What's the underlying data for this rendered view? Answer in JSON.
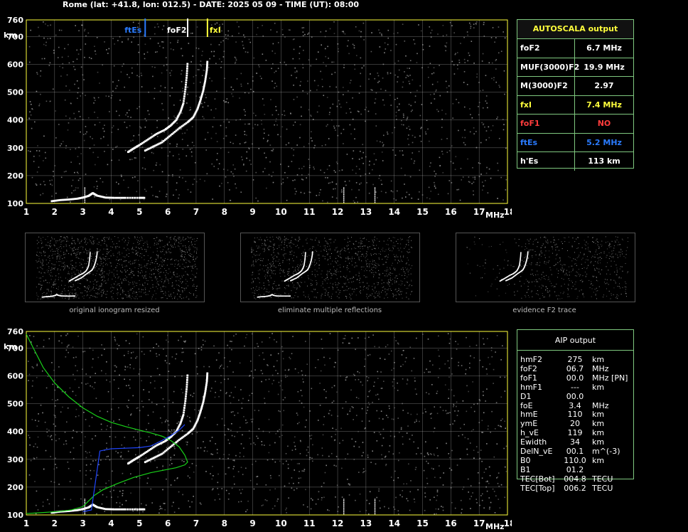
{
  "header": {
    "title": "Rome (lat: +41.8, lon: 012.5) - DATE: 2025 05 09 - TIME (UT): 08:00"
  },
  "colors": {
    "grid": "#c8c8c8",
    "axis": "#ffff3c",
    "trace": "#ffffff",
    "noise": "#8c8c8c",
    "ftEs": "#2a7bff",
    "fxI": "#ffff3c",
    "green": "#19d119",
    "blue": "#2046ff",
    "table_border": "#7fc87f",
    "foF1_red": "#ff3c3c"
  },
  "autoscala": {
    "title": "AUTOSCALA output",
    "rows": [
      {
        "label": "foF2",
        "value": "6.7  MHz",
        "color": "#ffffff"
      },
      {
        "label": "MUF(3000)F2",
        "value": "19.9 MHz",
        "color": "#ffffff"
      },
      {
        "label": "M(3000)F2",
        "value": "2.97",
        "color": "#ffffff"
      },
      {
        "label": "fxI",
        "value": "7.4  MHz",
        "color": "#ffff3c"
      },
      {
        "label": "foF1",
        "value": "NO",
        "color": "#ff3c3c"
      },
      {
        "label": "ftEs",
        "value": "5.2  MHz",
        "color": "#2a7bff"
      },
      {
        "label": "h'Es",
        "value": "113    km",
        "color": "#ffffff"
      }
    ]
  },
  "aip": {
    "title": "AIP output",
    "rows": [
      {
        "param": "hmF2",
        "value": "275",
        "unit": "km"
      },
      {
        "param": "foF2",
        "value": "06.7",
        "unit": "MHz"
      },
      {
        "param": "foF1",
        "value": "00.0",
        "unit": "MHz    [PN]"
      },
      {
        "param": "hmF1",
        "value": "---",
        "unit": "km"
      },
      {
        "param": "D1",
        "value": "00.0",
        "unit": ""
      },
      {
        "param": "foE",
        "value": "3.4",
        "unit": "MHz"
      },
      {
        "param": "hmE",
        "value": "110",
        "unit": "km"
      },
      {
        "param": "ymE",
        "value": "20",
        "unit": "km"
      },
      {
        "param": "h_vE",
        "value": "119",
        "unit": "km"
      },
      {
        "param": "Ewidth",
        "value": "34",
        "unit": "km"
      },
      {
        "param": "DelN_vE",
        "value": "00.1",
        "unit": "m^(-3)"
      },
      {
        "param": "B0",
        "value": "110.0",
        "unit": "km"
      },
      {
        "param": "B1",
        "value": "01.2",
        "unit": ""
      },
      {
        "param": "TEC[Bot]",
        "value": "004.8",
        "unit": "TECU"
      },
      {
        "param": "TEC[Top]",
        "value": "006.2",
        "unit": "TECU"
      }
    ]
  },
  "thumbnails": [
    {
      "caption": "original ionogram resized"
    },
    {
      "caption": "eliminate multiple reflections"
    },
    {
      "caption": "evidence F2 trace"
    }
  ],
  "chart_data": [
    {
      "type": "scatter",
      "panel": "top ionogram",
      "xlabel": "MHz",
      "ylabel": "km",
      "xlim": [
        1,
        18
      ],
      "ylim": [
        100,
        760
      ],
      "x_ticks": [
        1,
        2,
        3,
        4,
        5,
        6,
        7,
        8,
        9,
        10,
        11,
        12,
        13,
        14,
        15,
        16,
        17,
        18
      ],
      "y_ticks": [
        100,
        200,
        300,
        400,
        500,
        600,
        700,
        760
      ],
      "grid": true,
      "markers": [
        {
          "name": "ftEs",
          "x": 5.2,
          "color": "#2a7bff"
        },
        {
          "name": "foF2",
          "x": 6.7,
          "color": "#ffffff"
        },
        {
          "name": "fxI",
          "x": 7.4,
          "color": "#ffff3c"
        }
      ],
      "series": [
        {
          "name": "E/Es trace",
          "x": [
            1.9,
            2.2,
            2.5,
            2.8,
            3.0,
            3.2,
            3.35,
            3.5,
            3.8,
            4.1,
            4.5,
            5.0,
            5.2
          ],
          "y": [
            108,
            112,
            114,
            117,
            121,
            127,
            137,
            128,
            121,
            120,
            120,
            120,
            120
          ]
        },
        {
          "name": "O trace",
          "x": [
            4.6,
            4.8,
            5.0,
            5.3,
            5.6,
            5.9,
            6.1,
            6.3,
            6.45,
            6.55,
            6.62,
            6.67,
            6.7
          ],
          "y": [
            285,
            298,
            310,
            330,
            350,
            365,
            380,
            400,
            430,
            460,
            510,
            560,
            610
          ]
        },
        {
          "name": "X trace",
          "x": [
            5.2,
            5.5,
            5.8,
            6.1,
            6.4,
            6.7,
            6.9,
            7.05,
            7.15,
            7.25,
            7.32,
            7.38,
            7.4
          ],
          "y": [
            290,
            305,
            320,
            345,
            370,
            392,
            410,
            440,
            470,
            505,
            540,
            580,
            615
          ]
        }
      ]
    },
    {
      "type": "line",
      "panel": "bottom AIP profile",
      "xlabel": "MHz",
      "ylabel": "km",
      "xlim": [
        1,
        18
      ],
      "ylim": [
        100,
        760
      ],
      "x_ticks": [
        1,
        2,
        3,
        4,
        5,
        6,
        7,
        8,
        9,
        10,
        11,
        12,
        13,
        14,
        15,
        16,
        17,
        18
      ],
      "y_ticks": [
        100,
        200,
        300,
        400,
        500,
        600,
        700,
        760
      ],
      "grid": true,
      "series": [
        {
          "name": "green profile",
          "x": [
            1.0,
            1.3,
            1.6,
            2.0,
            2.5,
            3.0,
            3.5,
            4.0,
            4.5,
            5.0,
            5.4,
            5.8,
            6.1,
            6.4,
            6.6,
            6.7,
            6.6,
            6.3,
            5.9,
            5.4,
            4.8,
            4.2,
            3.7,
            3.4,
            3.2,
            3.0,
            2.6,
            2.1,
            1.5,
            1.0
          ],
          "y": [
            750,
            690,
            630,
            575,
            525,
            485,
            455,
            433,
            418,
            405,
            395,
            383,
            368,
            345,
            315,
            290,
            280,
            270,
            262,
            252,
            235,
            212,
            190,
            170,
            150,
            130,
            118,
            112,
            108,
            105
          ]
        },
        {
          "name": "blue profile",
          "x": [
            3.0,
            3.3,
            3.6,
            4.0,
            4.5,
            5.0,
            5.4,
            5.8,
            6.1,
            6.4,
            6.6
          ],
          "y": [
            112,
            118,
            330,
            338,
            340,
            342,
            348,
            368,
            385,
            405,
            425
          ]
        }
      ],
      "trace_series": [
        {
          "name": "E/Es trace",
          "x": [
            1.9,
            2.2,
            2.5,
            2.8,
            3.0,
            3.2,
            3.35,
            3.5,
            3.8,
            4.1,
            4.5,
            5.0,
            5.2
          ],
          "y": [
            108,
            112,
            114,
            117,
            121,
            127,
            137,
            128,
            121,
            120,
            120,
            120,
            120
          ]
        },
        {
          "name": "O trace",
          "x": [
            4.6,
            4.8,
            5.0,
            5.3,
            5.6,
            5.9,
            6.1,
            6.3,
            6.45,
            6.55,
            6.62,
            6.67,
            6.7
          ],
          "y": [
            285,
            298,
            310,
            330,
            350,
            365,
            380,
            400,
            430,
            460,
            510,
            560,
            610
          ]
        },
        {
          "name": "X trace",
          "x": [
            5.2,
            5.5,
            5.8,
            6.1,
            6.4,
            6.7,
            6.9,
            7.05,
            7.15,
            7.25,
            7.32,
            7.38,
            7.4
          ],
          "y": [
            290,
            305,
            320,
            345,
            370,
            392,
            410,
            440,
            470,
            505,
            540,
            580,
            615
          ]
        }
      ]
    }
  ]
}
